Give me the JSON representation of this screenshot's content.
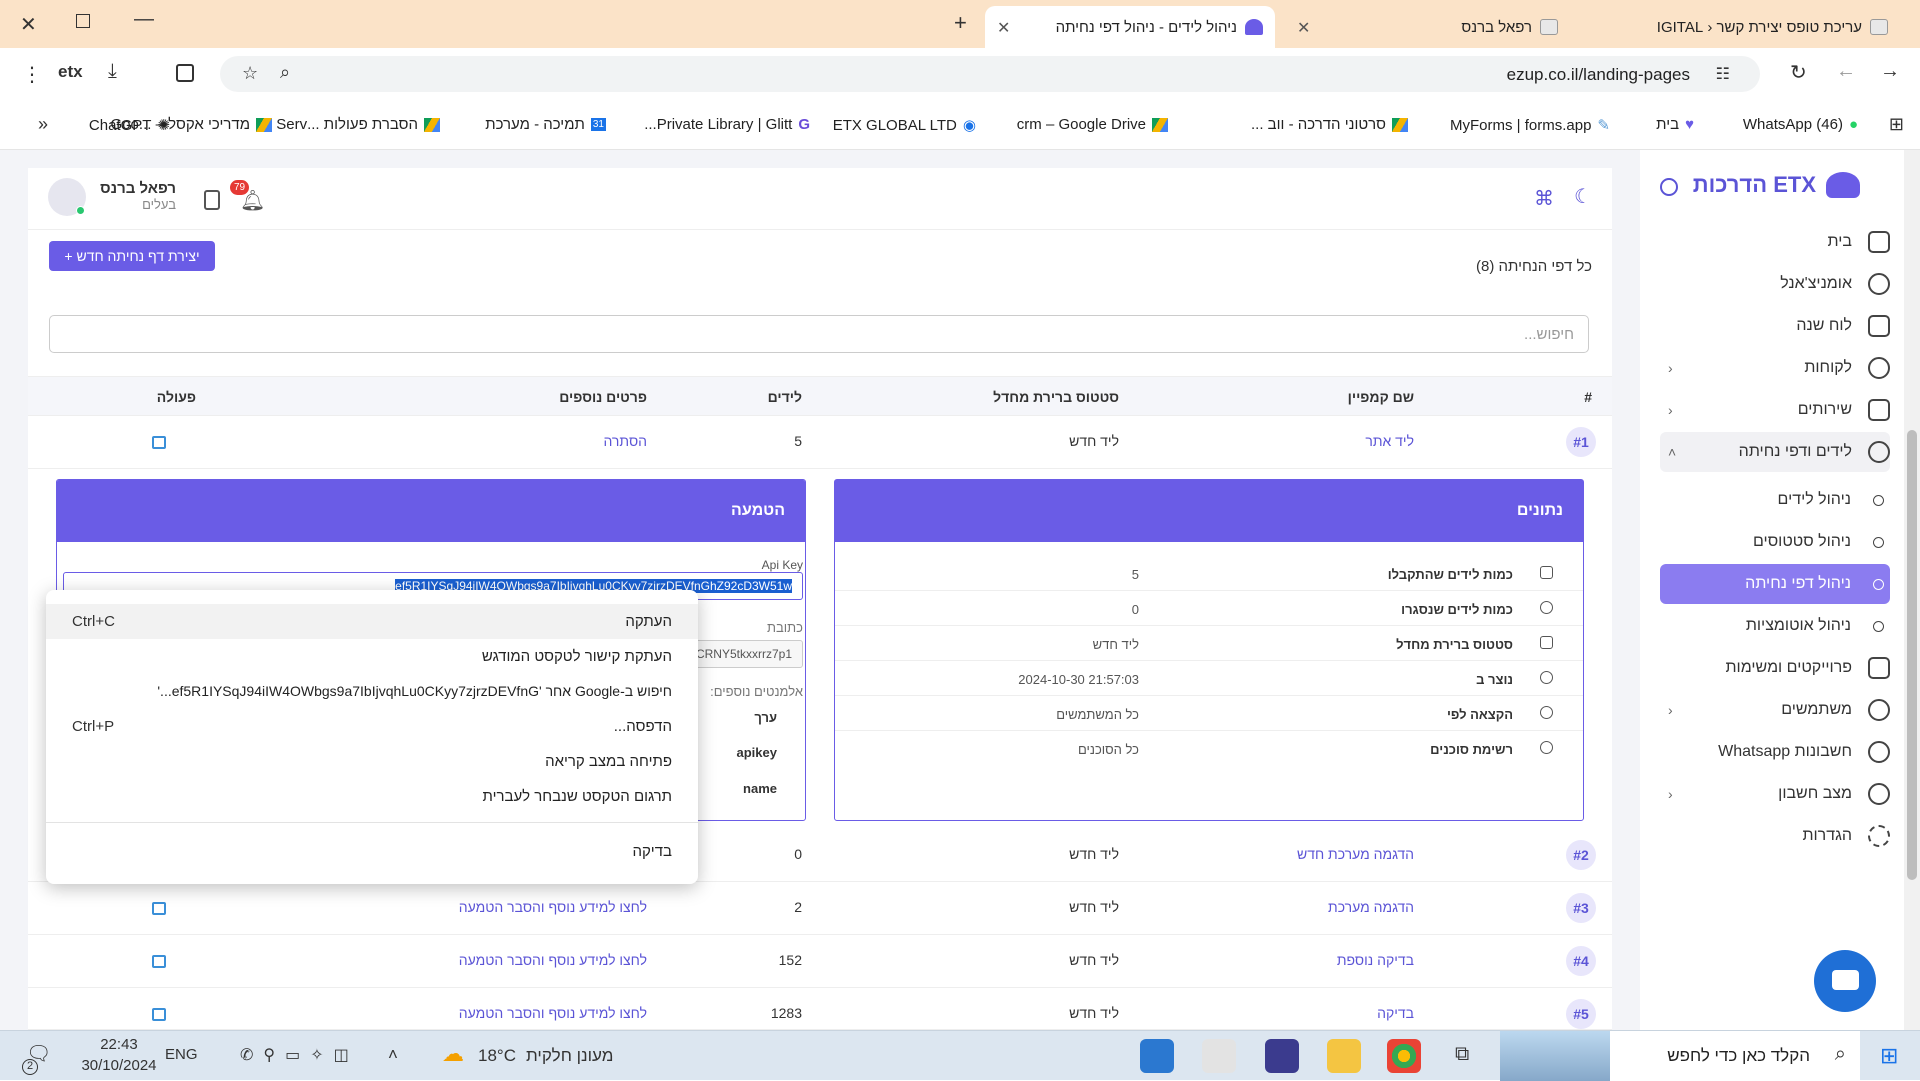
{
  "browser": {
    "tabs": [
      {
        "title": "עריכת טופס יצירת קשר ‹ IGITAL",
        "active": false
      },
      {
        "title": "רפאל ברנס",
        "active": false
      },
      {
        "title": "ניהול לידים - ניהול דפי נחיתה",
        "active": true
      }
    ],
    "url": "ezup.co.il/landing-pages",
    "bookmarks": [
      "בית",
      "(46) WhatsApp",
      "MyForms | forms.app",
      "סרטוני הדרכה - ווב ...",
      "crm – Google Drive",
      "ETX GLOBAL LTD",
      "Private Library | Glitt...",
      "תמיכה - מערכת",
      "הסברת פעולות ...Serv",
      "מדריכי אקסל – ...Goo",
      "ChatGPT"
    ]
  },
  "sidebar": {
    "brand": "ETX הדרכות",
    "items": [
      {
        "label": "בית",
        "icon": "home-icon",
        "chevron": false
      },
      {
        "label": "אומניצ'אנל",
        "icon": "chat-icon",
        "chevron": false
      },
      {
        "label": "לוח שנה",
        "icon": "calendar-icon",
        "chevron": false
      },
      {
        "label": "לקוחות",
        "icon": "users-icon",
        "chevron": true
      },
      {
        "label": "שירותים",
        "icon": "layers-icon",
        "chevron": true
      },
      {
        "label": "לידים ודפי נחיתה",
        "icon": "users-icon",
        "chevron": true
      },
      {
        "label": "ניהול לידים",
        "sub": true
      },
      {
        "label": "ניהול סטטוסים",
        "sub": true
      },
      {
        "label": "ניהול דפי נחיתה",
        "sub": true,
        "active": true
      },
      {
        "label": "ניהול אוטומציות",
        "sub": true
      },
      {
        "label": "פרוייקטים ומשימות",
        "icon": "check-icon",
        "chevron": false
      },
      {
        "label": "משתמשים",
        "icon": "users-icon",
        "chevron": true
      },
      {
        "label": "חשבונות Whatsapp",
        "icon": "users-icon",
        "chevron": false
      },
      {
        "label": "מצב חשבון",
        "icon": "users-icon",
        "chevron": true
      },
      {
        "label": "הגדרות",
        "icon": "gear-icon",
        "chevron": false
      }
    ]
  },
  "header": {
    "user_name": "רפאל ברנס",
    "user_role": "בעלים",
    "notifications": "79"
  },
  "content": {
    "create_button": "+ יצירת דף נחיתה חדש",
    "count_label": "כל דפי הנחיתה (8)",
    "search_placeholder": "חיפוש...",
    "columns": [
      "#",
      "שם קמפיין",
      "סטטוס ברירת מחדל",
      "לידים",
      "פרטים נוספים",
      "פעולה"
    ],
    "rows": [
      {
        "num": "#1",
        "campaign": "ליד אתר",
        "status": "ליד חדש",
        "leads": "5",
        "details": "הסתרה"
      },
      {
        "num": "#2",
        "campaign": "הדגמה מערכת חדש",
        "status": "ליד חדש",
        "leads": "0",
        "details": ""
      },
      {
        "num": "#3",
        "campaign": "הדגמה מערכת",
        "status": "ליד חדש",
        "leads": "2",
        "details": "לחצו למידע נוסף והסבר הטמעה"
      },
      {
        "num": "#4",
        "campaign": "בדיקה נוספת",
        "status": "ליד חדש",
        "leads": "152",
        "details": "לחצו למידע נוסף והסבר הטמעה"
      },
      {
        "num": "#5",
        "campaign": "בדיקה",
        "status": "ליד חדש",
        "leads": "1283",
        "details": "לחצו למידע נוסף והסבר הטמעה"
      }
    ],
    "data_card": {
      "title": "נתונים",
      "rows": [
        {
          "label": "כמות לידים שהתקבלו",
          "value": "5"
        },
        {
          "label": "כמות לידים שנסגרו",
          "value": "0"
        },
        {
          "label": "סטטוס ברירת מחדל",
          "value": "ליד חדש"
        },
        {
          "label": "נוצר ב",
          "value": "2024-10-30 21:57:03"
        },
        {
          "label": "הקצאה לפי",
          "value": "כל המשתמשים"
        },
        {
          "label": "רשימת סוכנים",
          "value": "כל הסוכנים"
        }
      ]
    },
    "embed_card": {
      "title": "הטמעה",
      "api_key_label": "Api Key",
      "api_key_value": "ef5R1IYSqJ94iIW4OWbgs9a7IbIjvqhLu0CKyy7zjrzDEVfnGhZ92cD3W51w",
      "address_label": "כתובת",
      "address_value": "5CRNY5tkxxrrz7p1",
      "extra_label": "אלמנטים נוספים:",
      "table": [
        "ערך",
        "apikey",
        "name"
      ]
    }
  },
  "context_menu": {
    "items": [
      {
        "label": "העתקה",
        "shortcut": "Ctrl+C"
      },
      {
        "label": "העתקת קישור לטקסט המודגש",
        "shortcut": ""
      },
      {
        "label": "חיפוש ב-Google אחר 'ef5R1IYSqJ94iIW4OWbgs9a7IbIjvqhLu0CKyy7zjrzDEVfnG...'",
        "shortcut": ""
      },
      {
        "label": "הדפסה...",
        "shortcut": "Ctrl+P"
      },
      {
        "label": "פתיחה במצב קריאה",
        "shortcut": ""
      },
      {
        "label": "תרגום הטקסט שנבחר לעברית",
        "shortcut": ""
      },
      {
        "label": "בדיקה",
        "shortcut": ""
      }
    ]
  },
  "taskbar": {
    "search_placeholder": "הקלד כאן כדי לחפש",
    "weather": "מעונן חלקית",
    "temp": "18°C",
    "time": "22:43",
    "date": "30/10/2024",
    "lang": "ENG",
    "notif_count": "2"
  },
  "colors": {
    "accent": "#6a5ce6",
    "tab_bar": "#fbe3c8",
    "page_bg": "#f3f4f8"
  }
}
